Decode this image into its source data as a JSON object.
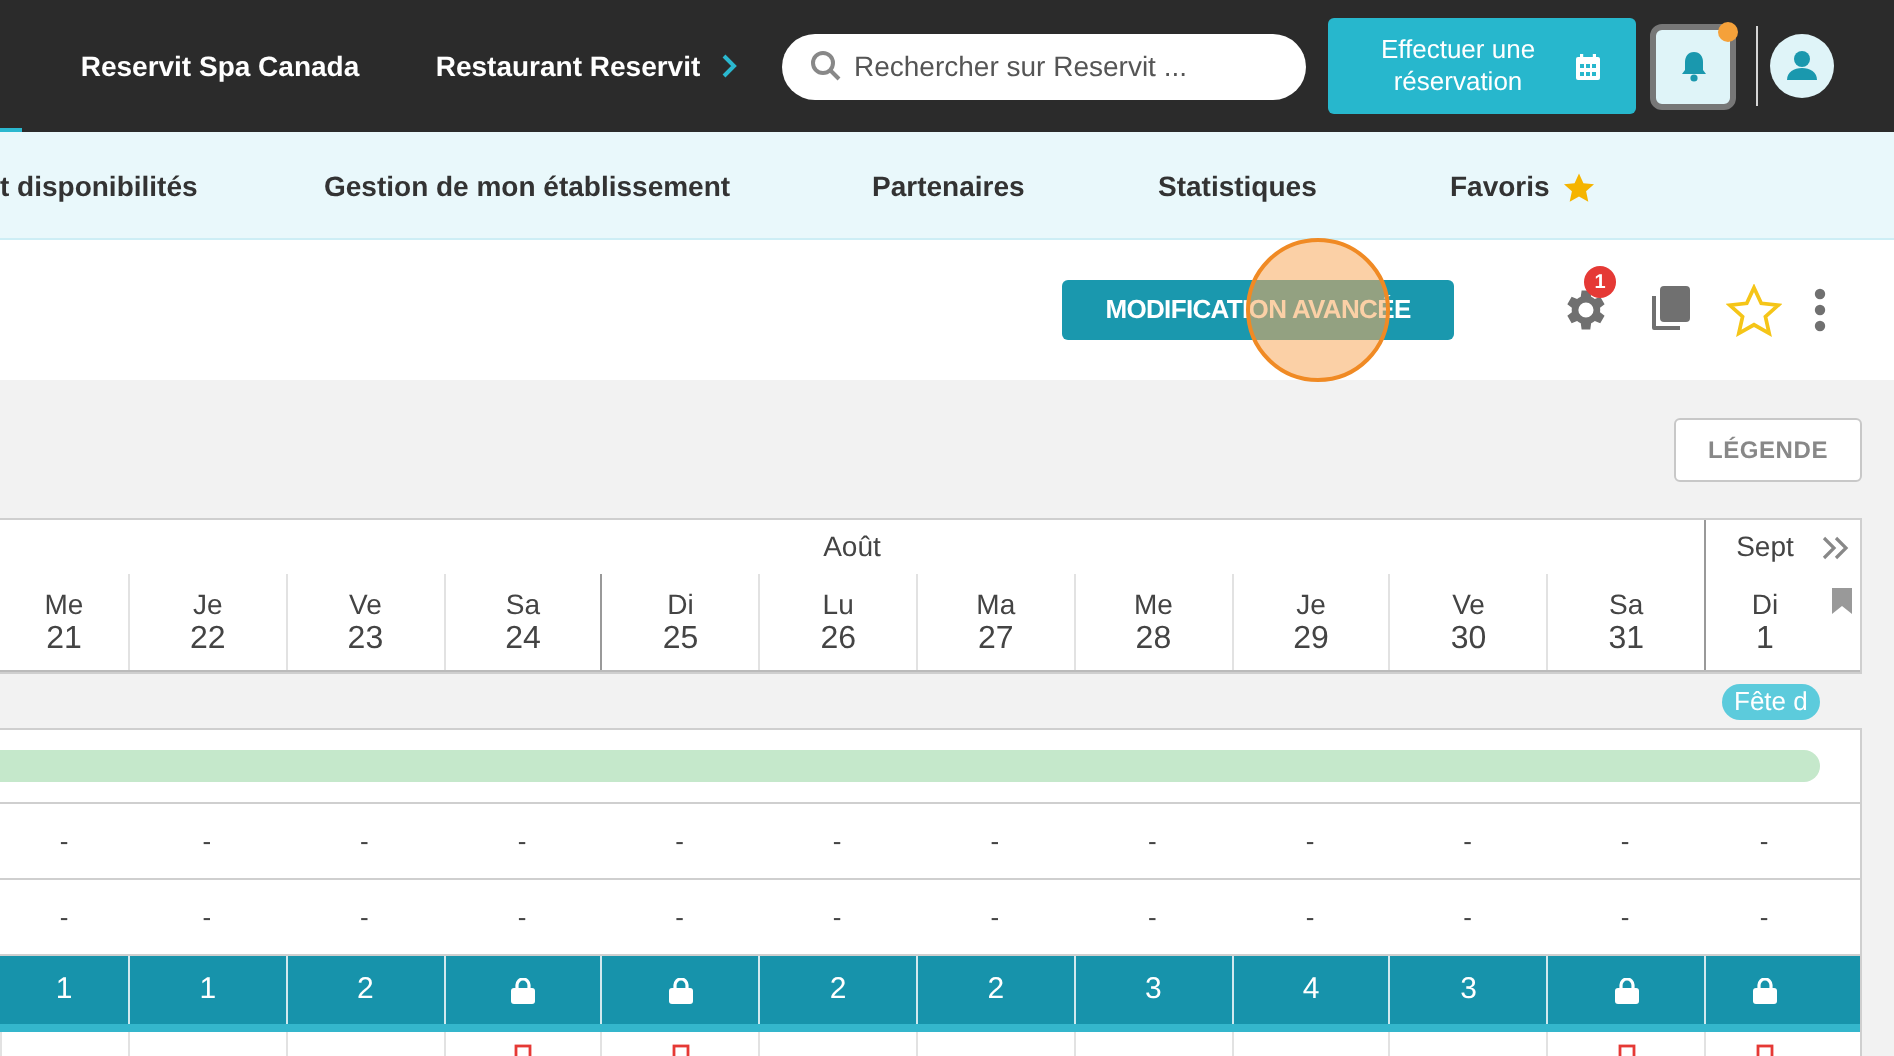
{
  "top_nav": {
    "items": [
      {
        "label": "Reservit Spa Canada"
      },
      {
        "label": "Restaurant Reservit"
      }
    ],
    "search": {
      "placeholder": "Rechercher sur Reservit ..."
    },
    "booking_button": "Effectuer une réservation",
    "notifications": {
      "unread": true
    }
  },
  "sub_nav": {
    "items": [
      {
        "label": "t disponibilités",
        "favorite": false
      },
      {
        "label": "Gestion de mon établissement",
        "favorite": false
      },
      {
        "label": "Partenaires",
        "favorite": false
      },
      {
        "label": "Statistiques",
        "favorite": false
      },
      {
        "label": "Favoris",
        "favorite": true
      }
    ]
  },
  "toolbar": {
    "advanced_button": "MODIFICATION AVANCÉE",
    "settings_badge": "1",
    "starred": false
  },
  "legend_button": "LÉGENDE",
  "calendar": {
    "months": [
      {
        "label": "Août"
      },
      {
        "label": "Sept"
      }
    ],
    "days": [
      {
        "weekday": "Me",
        "date": "21",
        "week_start": false
      },
      {
        "weekday": "Je",
        "date": "22",
        "week_start": false
      },
      {
        "weekday": "Ve",
        "date": "23",
        "week_start": false
      },
      {
        "weekday": "Sa",
        "date": "24",
        "week_start": false
      },
      {
        "weekday": "Di",
        "date": "25",
        "week_start": true
      },
      {
        "weekday": "Lu",
        "date": "26",
        "week_start": false
      },
      {
        "weekday": "Ma",
        "date": "27",
        "week_start": false
      },
      {
        "weekday": "Me",
        "date": "28",
        "week_start": false
      },
      {
        "weekday": "Je",
        "date": "29",
        "week_start": false
      },
      {
        "weekday": "Ve",
        "date": "30",
        "week_start": false
      },
      {
        "weekday": "Sa",
        "date": "31",
        "week_start": false
      },
      {
        "weekday": "Di",
        "date": "1",
        "week_start": true
      }
    ],
    "holiday": {
      "label": "Fête d"
    },
    "rows": [
      {
        "kind": "bar"
      },
      {
        "kind": "text",
        "cells": [
          "-",
          "-",
          "-",
          "-",
          "-",
          "-",
          "-",
          "-",
          "-",
          "-",
          "-",
          "-"
        ]
      },
      {
        "kind": "text",
        "cells": [
          "-",
          "-",
          "-",
          "-",
          "-",
          "-",
          "-",
          "-",
          "-",
          "-",
          "-",
          "-"
        ]
      },
      {
        "kind": "stock",
        "cells": [
          {
            "kind": "number",
            "value": "1"
          },
          {
            "kind": "number",
            "value": "1"
          },
          {
            "kind": "number",
            "value": "2"
          },
          {
            "kind": "locked"
          },
          {
            "kind": "locked"
          },
          {
            "kind": "number",
            "value": "2"
          },
          {
            "kind": "number",
            "value": "2"
          },
          {
            "kind": "number",
            "value": "3"
          },
          {
            "kind": "number",
            "value": "4"
          },
          {
            "kind": "number",
            "value": "3"
          },
          {
            "kind": "locked"
          },
          {
            "kind": "locked"
          }
        ]
      },
      {
        "kind": "flags",
        "cells": [
          false,
          false,
          false,
          true,
          true,
          false,
          false,
          false,
          false,
          false,
          true,
          true
        ]
      }
    ]
  }
}
